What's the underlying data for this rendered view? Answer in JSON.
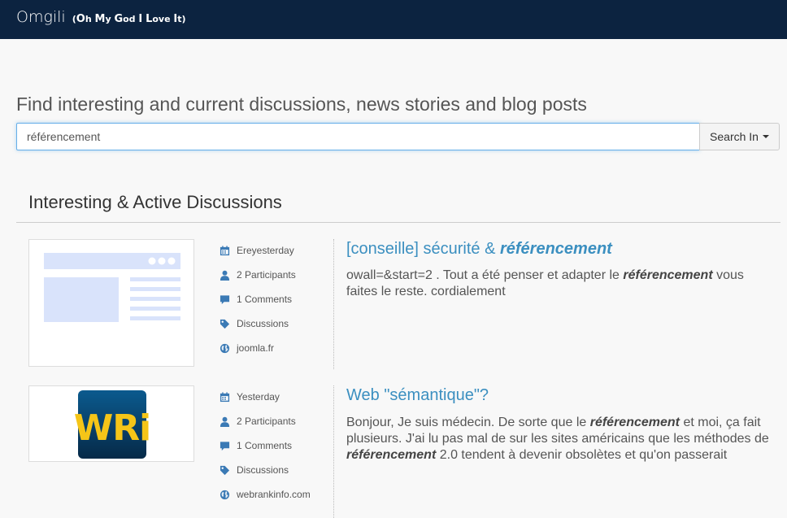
{
  "brand": {
    "name": "Omgili",
    "tag_open": "(",
    "tag_parts": [
      {
        "cap": "O",
        "rest": "h "
      },
      {
        "cap": "M",
        "rest": "y "
      },
      {
        "cap": "G",
        "rest": "od "
      },
      {
        "cap": "I",
        "rest": " "
      },
      {
        "cap": "L",
        "rest": "ove "
      },
      {
        "cap": "I",
        "rest": "t"
      }
    ],
    "tag_close": ")"
  },
  "headline": "Find interesting and current discussions, news stories and blog posts",
  "search": {
    "value": "référencement",
    "button_label": "Search In"
  },
  "section": {
    "title": "Interesting & Active Discussions"
  },
  "results": [
    {
      "meta": {
        "date": "Ereyesterday",
        "participants": "2 Participants",
        "comments": "1 Comments",
        "category": "Discussions",
        "site": "joomla.fr"
      },
      "title_plain": "[conseille] sécurité & ",
      "title_em": "référencement",
      "snippet": [
        {
          "t": "owall=&start=2 . Tout a été penser et adapter le "
        },
        {
          "t": "référencement",
          "em": true
        },
        {
          "t": " vous faites le reste. cordialement"
        }
      ]
    },
    {
      "meta": {
        "date": "Yesterday",
        "participants": "2 Participants",
        "comments": "1 Comments",
        "category": "Discussions",
        "site": "webrankinfo.com"
      },
      "title_plain": "Web \"sémantique\"?",
      "title_em": "",
      "logo_text": "WRi",
      "snippet": [
        {
          "t": "Bonjour, Je suis médecin. De sorte que le "
        },
        {
          "t": "référencement",
          "em": true
        },
        {
          "t": " et moi, ça fait plusieurs. J'ai lu pas mal de sur les sites américains que les méthodes de "
        },
        {
          "t": "référencement",
          "em": true
        },
        {
          "t": " 2.0 tendent à devenir obsolètes et qu'on passerait"
        }
      ]
    }
  ],
  "colors": {
    "navbar": "#0c2340",
    "link": "#3b8fc0",
    "icon": "#3b7ab5",
    "placeholder_thumb": "#d9e3fb"
  }
}
